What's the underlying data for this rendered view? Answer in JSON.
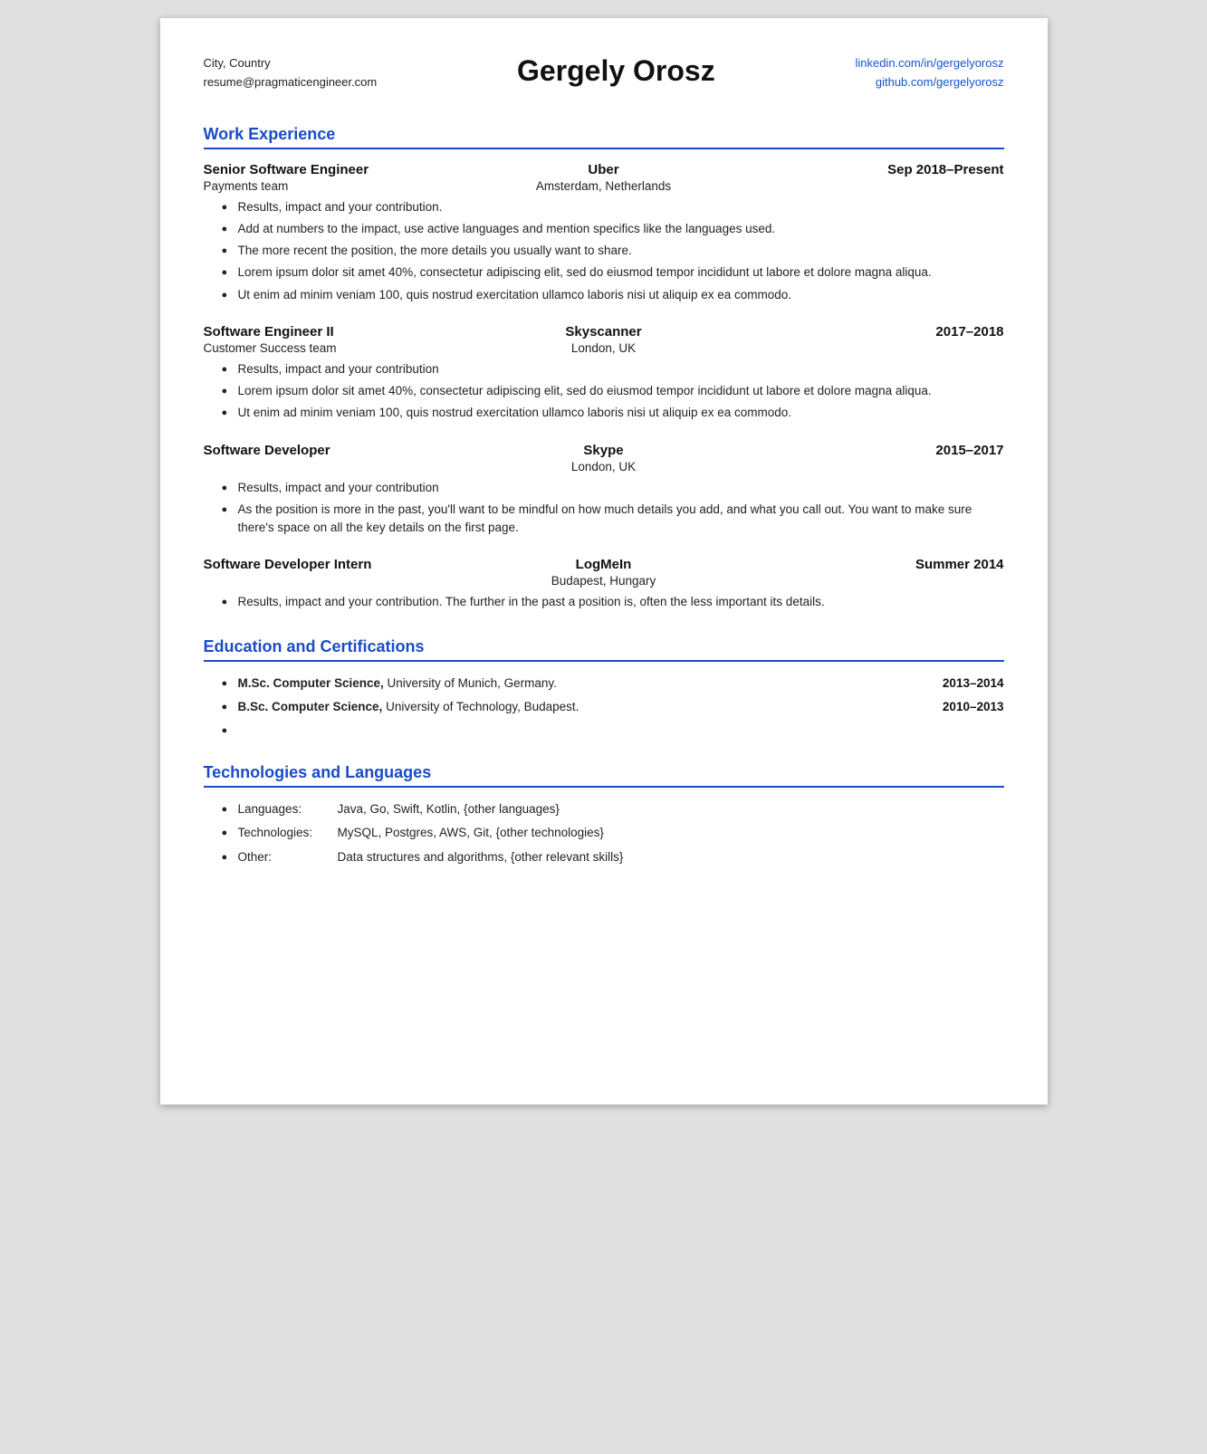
{
  "header": {
    "name": "Gergely Orosz",
    "city": "City, Country",
    "email": "resume@pragmaticengineer.com",
    "linkedin": "linkedin.com/in/gergelyorosz",
    "github": "github.com/gergelyorosz"
  },
  "sections": {
    "work_experience": {
      "title": "Work Experience",
      "jobs": [
        {
          "title": "Senior Software Engineer",
          "company": "Uber",
          "dates": "Sep 2018–Present",
          "team": "Payments team",
          "location": "Amsterdam, Netherlands",
          "bullets": [
            "Results, impact and your contribution.",
            "Add at numbers to the impact, use active languages and mention specifics like the languages used.",
            "The more recent the position, the more details you usually want to share.",
            "Lorem ipsum dolor sit amet 40%, consectetur adipiscing elit, sed do eiusmod tempor incididunt ut labore et dolore magna aliqua.",
            "Ut enim ad minim veniam 100, quis nostrud exercitation ullamco laboris nisi ut aliquip ex ea commodo."
          ]
        },
        {
          "title": "Software Engineer II",
          "company": "Skyscanner",
          "dates": "2017–2018",
          "team": "Customer Success team",
          "location": "London, UK",
          "bullets": [
            "Results, impact and your contribution",
            "Lorem ipsum dolor sit amet 40%, consectetur adipiscing elit, sed do eiusmod tempor incididunt ut labore et dolore magna aliqua.",
            "Ut enim ad minim veniam 100, quis nostrud exercitation ullamco laboris nisi ut aliquip ex ea commodo."
          ]
        },
        {
          "title": "Software Developer",
          "company": "Skype",
          "dates": "2015–2017",
          "team": "",
          "location": "London, UK",
          "bullets": [
            "Results, impact and your contribution",
            "As the position is more in the past, you'll want to be mindful on how much details you add, and what you call out. You want to make sure there's space on all the key details on the first page."
          ]
        },
        {
          "title": "Software Developer Intern",
          "company": "LogMeIn",
          "dates": "Summer 2014",
          "team": "",
          "location": "Budapest, Hungary",
          "bullets": [
            "Results, impact and your contribution. The further in the past a position is, often the less important its details."
          ]
        }
      ]
    },
    "education": {
      "title": "Education and Certifications",
      "items": [
        {
          "text_bold": "M.Sc. Computer Science,",
          "text_regular": " University of Munich, Germany.",
          "dates": "2013–2014"
        },
        {
          "text_bold": "B.Sc. Computer Science,",
          "text_regular": " University of Technology, Budapest.",
          "dates": "2010–2013"
        },
        {
          "text_bold": "",
          "text_regular": "",
          "dates": ""
        }
      ]
    },
    "technologies": {
      "title": "Technologies and Languages",
      "items": [
        {
          "label": "Languages:",
          "value": "Java, Go, Swift, Kotlin, {other languages}"
        },
        {
          "label": "Technologies:",
          "value": "MySQL, Postgres, AWS, Git, {other technologies}"
        },
        {
          "label": "Other:",
          "value": "Data structures and algorithms, {other relevant skills}"
        }
      ]
    }
  }
}
